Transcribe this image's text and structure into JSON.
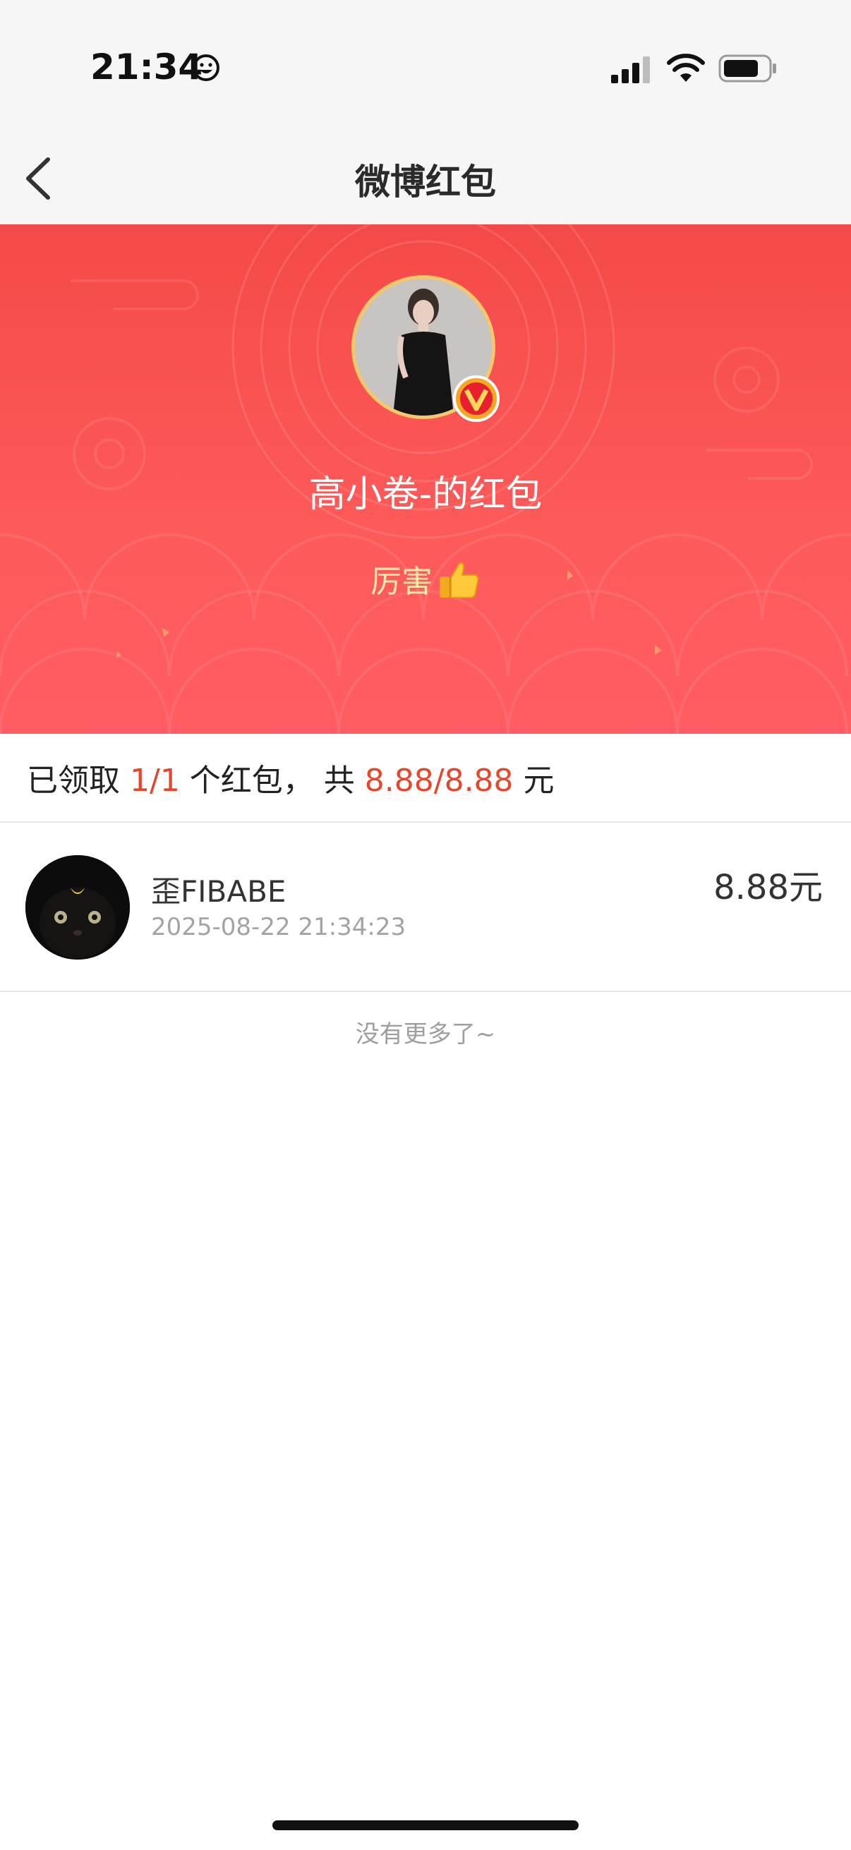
{
  "status_bar": {
    "time": "21:34"
  },
  "nav": {
    "title": "微博红包"
  },
  "header": {
    "sender_name": "高小卷-的红包",
    "greeting": "厉害"
  },
  "summary": {
    "prefix": "已领取 ",
    "claimed": "1/1",
    "middle": " 个红包， 共 ",
    "amount": "8.88/8.88",
    "suffix": " 元"
  },
  "records": [
    {
      "name": "歪FIBABE",
      "time": "2025-08-22 21:34:23",
      "amount": "8.88元"
    }
  ],
  "footer": {
    "no_more": "没有更多了~"
  },
  "colors": {
    "header_red": "#f44a47",
    "highlight": "#e6462c",
    "greeting": "#ffe9a8"
  },
  "icons": [
    "smiley-icon",
    "signal-icon",
    "wifi-icon",
    "battery-icon",
    "back-arrow-icon",
    "verified-v-icon",
    "thumbs-up-icon"
  ]
}
